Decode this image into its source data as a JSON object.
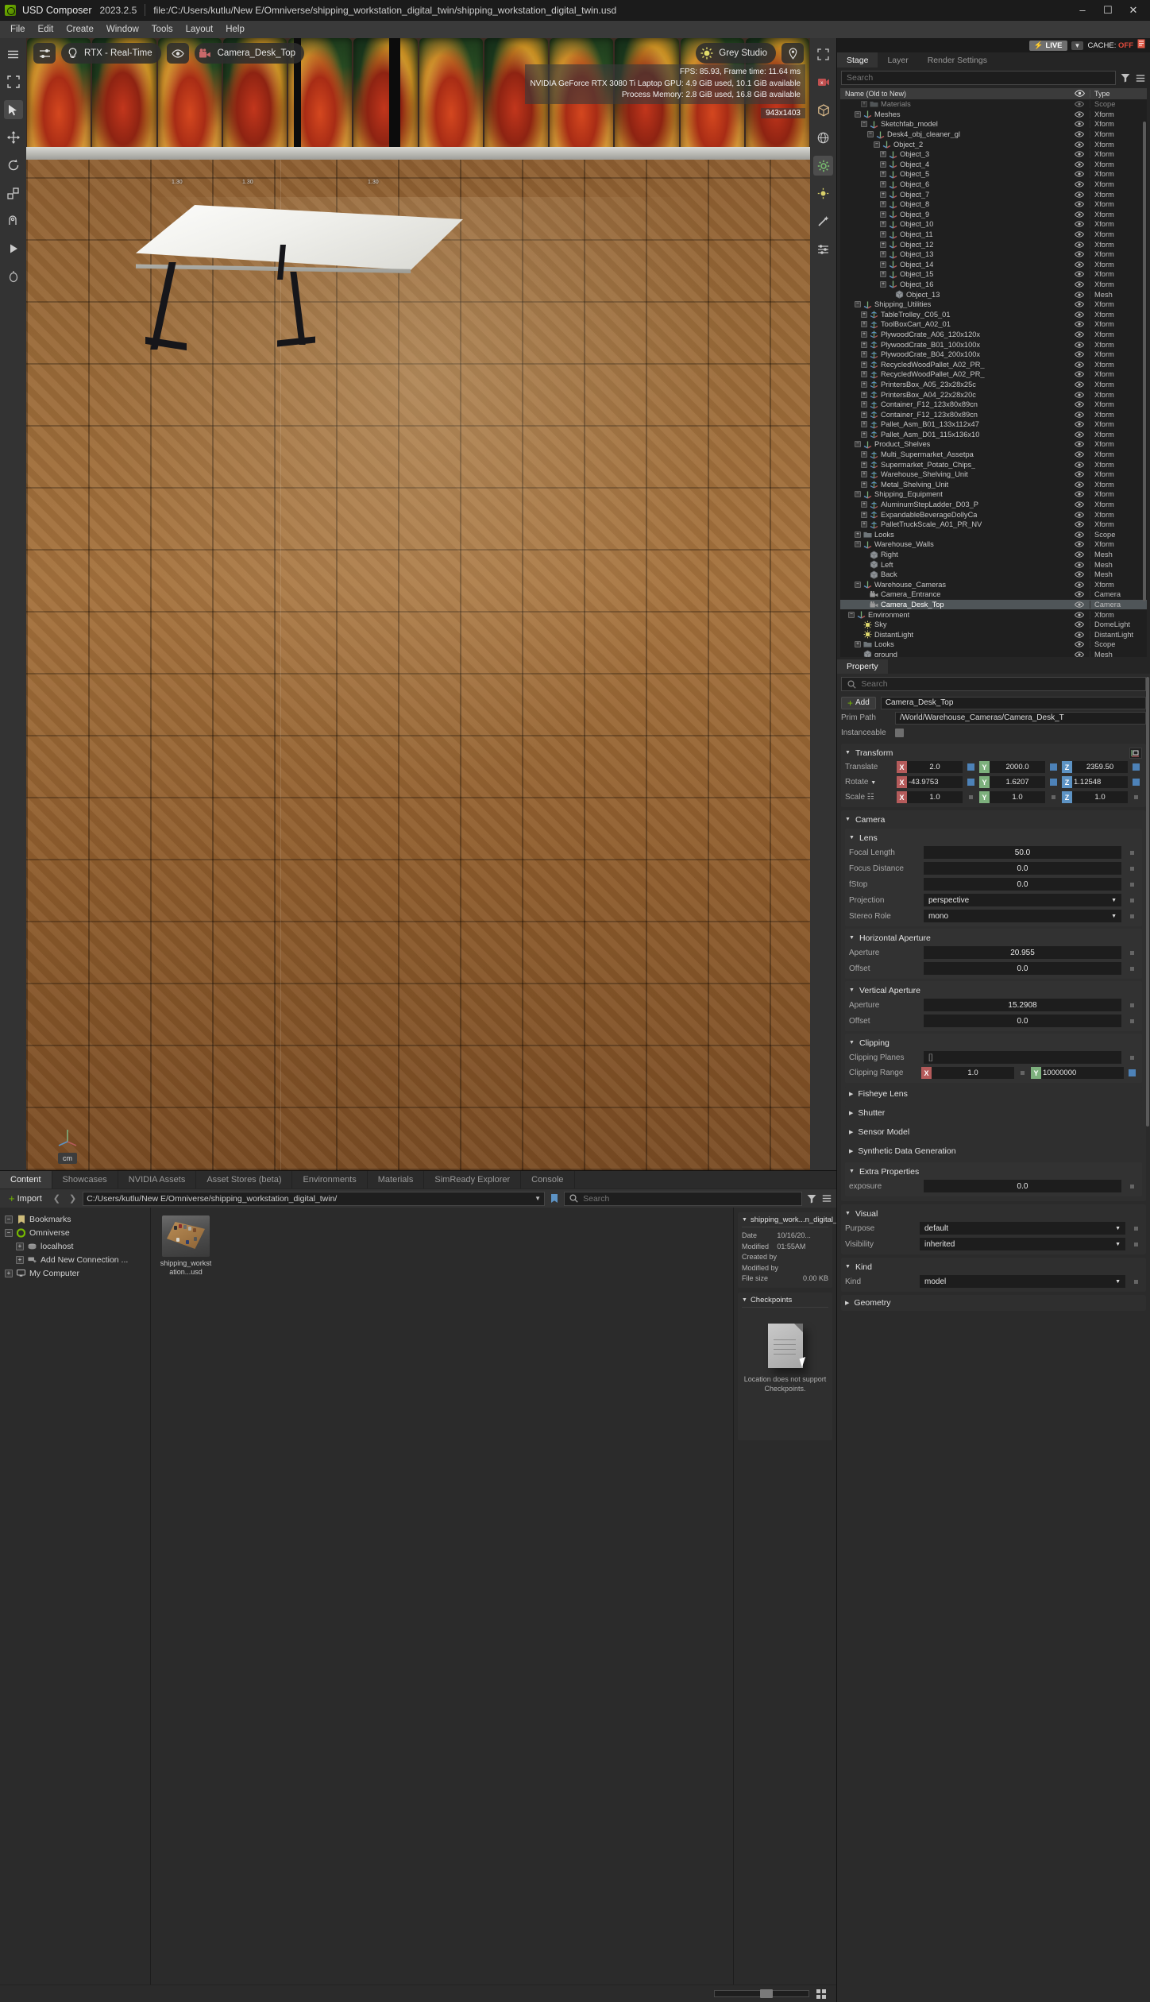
{
  "titlebar": {
    "app_name": "USD Composer",
    "version": "2023.2.5",
    "file_path": "file:/C:/Users/kutlu/New E/Omniverse/shipping_workstation_digital_twin/shipping_workstation_digital_twin.usd",
    "minimize": "–",
    "maximize": "☐",
    "close": "✕"
  },
  "menubar": {
    "items": [
      "File",
      "Edit",
      "Create",
      "Window",
      "Tools",
      "Layout",
      "Help"
    ]
  },
  "viewport": {
    "render_mode": "RTX - Real-Time",
    "camera": "Camera_Desk_Top",
    "lighting_preset": "Grey Studio",
    "stats": [
      "FPS: 85.93, Frame time: 11.64 ms",
      "NVIDIA GeForce RTX 3080 Ti Laptop GPU: 4.9 GiB used, 10.1 GiB available",
      "Process Memory: 2.8 GiB used, 16.8 GiB available"
    ],
    "resolution": "943x1403",
    "unit": "cm",
    "dimension_labels": [
      "1.30",
      "1.30",
      "1.30"
    ],
    "toolbar_icons": [
      "menu-icon",
      "select-tool-icon",
      "move-tool-icon",
      "rotate-tool-icon",
      "scale-tool-icon",
      "snap-tool-icon",
      "play-tool-icon",
      "physics-tool-icon"
    ],
    "rail_icons": [
      "expand-icon",
      "camera-record-icon",
      "cube-icon",
      "globe-icon",
      "gear-icon",
      "sun-icon",
      "wand-icon",
      "sliders-icon"
    ],
    "hud_icons": [
      "settings-sliders-icon",
      "lightbulb-icon",
      "eye-icon",
      "camera-icon",
      "sun-icon",
      "location-pin-icon"
    ]
  },
  "stage": {
    "live_label": "LIVE",
    "cache_label": "CACHE:",
    "cache_value": "OFF",
    "tabs": [
      {
        "label": "Stage",
        "active": true
      },
      {
        "label": "Layer",
        "active": false
      },
      {
        "label": "Render Settings",
        "active": false
      }
    ],
    "search_placeholder": "Search",
    "columns": {
      "name": "Name (Old to New)",
      "eye": "eye-icon",
      "type": "Type"
    },
    "rows": [
      {
        "indent": 3,
        "exp": "+",
        "icon": "scope-icon",
        "label": "Materials",
        "type": "Scope",
        "sel": false,
        "dim": true
      },
      {
        "indent": 2,
        "exp": "−",
        "icon": "xform-icon",
        "label": "Meshes",
        "type": "Xform",
        "sel": false
      },
      {
        "indent": 3,
        "exp": "−",
        "icon": "xform-icon",
        "label": "Sketchfab_model",
        "type": "Xform",
        "sel": false
      },
      {
        "indent": 4,
        "exp": "−",
        "icon": "xform-icon",
        "label": "Desk4_obj_cleaner_gl",
        "type": "Xform",
        "sel": false
      },
      {
        "indent": 5,
        "exp": "−",
        "icon": "xform-icon",
        "label": "Object_2",
        "type": "Xform",
        "sel": false
      },
      {
        "indent": 6,
        "exp": "+",
        "icon": "xform-icon",
        "label": "Object_3",
        "type": "Xform",
        "sel": false
      },
      {
        "indent": 6,
        "exp": "+",
        "icon": "xform-icon",
        "label": "Object_4",
        "type": "Xform",
        "sel": false
      },
      {
        "indent": 6,
        "exp": "+",
        "icon": "xform-icon",
        "label": "Object_5",
        "type": "Xform",
        "sel": false
      },
      {
        "indent": 6,
        "exp": "+",
        "icon": "xform-icon",
        "label": "Object_6",
        "type": "Xform",
        "sel": false
      },
      {
        "indent": 6,
        "exp": "+",
        "icon": "xform-icon",
        "label": "Object_7",
        "type": "Xform",
        "sel": false
      },
      {
        "indent": 6,
        "exp": "+",
        "icon": "xform-icon",
        "label": "Object_8",
        "type": "Xform",
        "sel": false
      },
      {
        "indent": 6,
        "exp": "+",
        "icon": "xform-icon",
        "label": "Object_9",
        "type": "Xform",
        "sel": false
      },
      {
        "indent": 6,
        "exp": "+",
        "icon": "xform-icon",
        "label": "Object_10",
        "type": "Xform",
        "sel": false
      },
      {
        "indent": 6,
        "exp": "+",
        "icon": "xform-icon",
        "label": "Object_11",
        "type": "Xform",
        "sel": false
      },
      {
        "indent": 6,
        "exp": "+",
        "icon": "xform-icon",
        "label": "Object_12",
        "type": "Xform",
        "sel": false
      },
      {
        "indent": 6,
        "exp": "+",
        "icon": "xform-icon",
        "label": "Object_13",
        "type": "Xform",
        "sel": false
      },
      {
        "indent": 6,
        "exp": "+",
        "icon": "xform-icon",
        "label": "Object_14",
        "type": "Xform",
        "sel": false
      },
      {
        "indent": 6,
        "exp": "+",
        "icon": "xform-icon",
        "label": "Object_15",
        "type": "Xform",
        "sel": false
      },
      {
        "indent": 6,
        "exp": "+",
        "icon": "xform-icon",
        "label": "Object_16",
        "type": "Xform",
        "sel": false
      },
      {
        "indent": 7,
        "exp": "",
        "icon": "mesh-icon",
        "label": "Object_13",
        "type": "Mesh",
        "sel": false
      },
      {
        "indent": 2,
        "exp": "−",
        "icon": "xform-icon",
        "label": "Shipping_Utilities",
        "type": "Xform",
        "sel": false
      },
      {
        "indent": 3,
        "exp": "+",
        "icon": "payload-icon",
        "label": "TableTrolley_C05_01",
        "type": "Xform",
        "sel": false
      },
      {
        "indent": 3,
        "exp": "+",
        "icon": "payload-icon",
        "label": "ToolBoxCart_A02_01",
        "type": "Xform",
        "sel": false
      },
      {
        "indent": 3,
        "exp": "+",
        "icon": "payload-icon",
        "label": "PlywoodCrate_A06_120x120x",
        "type": "Xform",
        "sel": false
      },
      {
        "indent": 3,
        "exp": "+",
        "icon": "payload-icon",
        "label": "PlywoodCrate_B01_100x100x",
        "type": "Xform",
        "sel": false
      },
      {
        "indent": 3,
        "exp": "+",
        "icon": "payload-icon",
        "label": "PlywoodCrate_B04_200x100x",
        "type": "Xform",
        "sel": false
      },
      {
        "indent": 3,
        "exp": "+",
        "icon": "payload-icon",
        "label": "RecycledWoodPallet_A02_PR_",
        "type": "Xform",
        "sel": false
      },
      {
        "indent": 3,
        "exp": "+",
        "icon": "payload-icon",
        "label": "RecycledWoodPallet_A02_PR_",
        "type": "Xform",
        "sel": false
      },
      {
        "indent": 3,
        "exp": "+",
        "icon": "payload-icon",
        "label": "PrintersBox_A05_23x28x25c",
        "type": "Xform",
        "sel": false
      },
      {
        "indent": 3,
        "exp": "+",
        "icon": "payload-icon",
        "label": "PrintersBox_A04_22x28x20c",
        "type": "Xform",
        "sel": false
      },
      {
        "indent": 3,
        "exp": "+",
        "icon": "payload-icon",
        "label": "Container_F12_123x80x89cn",
        "type": "Xform",
        "sel": false
      },
      {
        "indent": 3,
        "exp": "+",
        "icon": "payload-icon",
        "label": "Container_F12_123x80x89cn",
        "type": "Xform",
        "sel": false
      },
      {
        "indent": 3,
        "exp": "+",
        "icon": "payload-icon",
        "label": "Pallet_Asm_B01_133x112x47",
        "type": "Xform",
        "sel": false
      },
      {
        "indent": 3,
        "exp": "+",
        "icon": "payload-icon",
        "label": "Pallet_Asm_D01_115x136x10",
        "type": "Xform",
        "sel": false
      },
      {
        "indent": 2,
        "exp": "−",
        "icon": "xform-icon",
        "label": "Product_Shelves",
        "type": "Xform",
        "sel": false
      },
      {
        "indent": 3,
        "exp": "+",
        "icon": "payload-icon",
        "label": "Multi_Supermarket_Assetpa",
        "type": "Xform",
        "sel": false
      },
      {
        "indent": 3,
        "exp": "+",
        "icon": "payload-icon",
        "label": "Supermarket_Potato_Chips_",
        "type": "Xform",
        "sel": false
      },
      {
        "indent": 3,
        "exp": "+",
        "icon": "payload-icon",
        "label": "Warehouse_Shelving_Unit",
        "type": "Xform",
        "sel": false
      },
      {
        "indent": 3,
        "exp": "+",
        "icon": "payload-icon",
        "label": "Metal_Shelving_Unit",
        "type": "Xform",
        "sel": false
      },
      {
        "indent": 2,
        "exp": "−",
        "icon": "xform-icon",
        "label": "Shipping_Equipment",
        "type": "Xform",
        "sel": false
      },
      {
        "indent": 3,
        "exp": "+",
        "icon": "payload-icon",
        "label": "AluminumStepLadder_D03_P",
        "type": "Xform",
        "sel": false
      },
      {
        "indent": 3,
        "exp": "+",
        "icon": "payload-icon",
        "label": "ExpandableBeverageDollyCa",
        "type": "Xform",
        "sel": false
      },
      {
        "indent": 3,
        "exp": "+",
        "icon": "payload-icon",
        "label": "PalletTruckScale_A01_PR_NV",
        "type": "Xform",
        "sel": false
      },
      {
        "indent": 2,
        "exp": "+",
        "icon": "scope-icon",
        "label": "Looks",
        "type": "Scope",
        "sel": false
      },
      {
        "indent": 2,
        "exp": "−",
        "icon": "xform-icon",
        "label": "Warehouse_Walls",
        "type": "Xform",
        "sel": false
      },
      {
        "indent": 3,
        "exp": "",
        "icon": "mesh-icon",
        "label": "Right",
        "type": "Mesh",
        "sel": false
      },
      {
        "indent": 3,
        "exp": "",
        "icon": "mesh-icon",
        "label": "Left",
        "type": "Mesh",
        "sel": false
      },
      {
        "indent": 3,
        "exp": "",
        "icon": "mesh-icon",
        "label": "Back",
        "type": "Mesh",
        "sel": false
      },
      {
        "indent": 2,
        "exp": "−",
        "icon": "xform-icon",
        "label": "Warehouse_Cameras",
        "type": "Xform",
        "sel": false
      },
      {
        "indent": 3,
        "exp": "",
        "icon": "camera-icon",
        "label": "Camera_Entrance",
        "type": "Camera",
        "sel": false
      },
      {
        "indent": 3,
        "exp": "",
        "icon": "camera-icon",
        "label": "Camera_Desk_Top",
        "type": "Camera",
        "sel": true
      },
      {
        "indent": 1,
        "exp": "−",
        "icon": "xform-icon",
        "label": "Environment",
        "type": "Xform",
        "sel": false
      },
      {
        "indent": 2,
        "exp": "",
        "icon": "light-icon",
        "label": "Sky",
        "type": "DomeLight",
        "sel": false
      },
      {
        "indent": 2,
        "exp": "",
        "icon": "light-icon",
        "label": "DistantLight",
        "type": "DistantLight",
        "sel": false
      },
      {
        "indent": 2,
        "exp": "+",
        "icon": "scope-icon",
        "label": "Looks",
        "type": "Scope",
        "sel": false
      },
      {
        "indent": 2,
        "exp": "",
        "icon": "mesh-icon",
        "label": "ground",
        "type": "Mesh",
        "sel": false
      }
    ]
  },
  "property": {
    "tab_label": "Property",
    "search_placeholder": "Search",
    "add_label": "Add",
    "prim_name": "Camera_Desk_Top",
    "prim_path_label": "Prim Path",
    "prim_path_value": "/World/Warehouse_Cameras/Camera_Desk_T",
    "instanceable_label": "Instanceable",
    "transform": {
      "title": "Transform",
      "translate_label": "Translate",
      "translate": {
        "x": "2.0",
        "y": "2000.0",
        "z": "2359.50"
      },
      "rotate_label": "Rotate",
      "rotate": {
        "x": "-43.9753",
        "y": "1.6207",
        "z": "1.12548"
      },
      "scale_label": "Scale",
      "scale": {
        "x": "1.0",
        "y": "1.0",
        "z": "1.0"
      }
    },
    "camera": {
      "title": "Camera",
      "lens": {
        "title": "Lens",
        "rows": [
          {
            "label": "Focal Length",
            "value": "50.0",
            "type": "num"
          },
          {
            "label": "Focus Distance",
            "value": "0.0",
            "type": "num"
          },
          {
            "label": "fStop",
            "value": "0.0",
            "type": "num"
          },
          {
            "label": "Projection",
            "value": "perspective",
            "type": "select"
          },
          {
            "label": "Stereo Role",
            "value": "mono",
            "type": "select"
          }
        ]
      },
      "horizontal_aperture": {
        "title": "Horizontal Aperture",
        "rows": [
          {
            "label": "Aperture",
            "value": "20.955",
            "type": "num"
          },
          {
            "label": "Offset",
            "value": "0.0",
            "type": "num"
          }
        ]
      },
      "vertical_aperture": {
        "title": "Vertical Aperture",
        "rows": [
          {
            "label": "Aperture",
            "value": "15.2908",
            "type": "num"
          },
          {
            "label": "Offset",
            "value": "0.0",
            "type": "num"
          }
        ]
      },
      "clipping": {
        "title": "Clipping",
        "planes_label": "Clipping Planes",
        "planes_value": "[]",
        "range_label": "Clipping Range",
        "range": {
          "x": "1.0",
          "y": "10000000"
        }
      },
      "collapsed_sections": [
        "Fisheye Lens",
        "Shutter",
        "Sensor Model",
        "Synthetic Data Generation"
      ],
      "extra": {
        "title": "Extra Properties",
        "rows": [
          {
            "label": "exposure",
            "value": "0.0",
            "type": "num"
          }
        ]
      }
    },
    "visual": {
      "title": "Visual",
      "rows": [
        {
          "label": "Purpose",
          "value": "default",
          "type": "select"
        },
        {
          "label": "Visibility",
          "value": "inherited",
          "type": "select"
        }
      ]
    },
    "kind": {
      "title": "Kind",
      "rows": [
        {
          "label": "Kind",
          "value": "model",
          "type": "select"
        }
      ]
    },
    "geometry_title": "Geometry"
  },
  "content": {
    "tabs": [
      {
        "label": "Content",
        "active": true
      },
      {
        "label": "Showcases",
        "active": false
      },
      {
        "label": "NVIDIA Assets",
        "active": false
      },
      {
        "label": "Asset Stores (beta)",
        "active": false
      },
      {
        "label": "Environments",
        "active": false
      },
      {
        "label": "Materials",
        "active": false
      },
      {
        "label": "SimReady Explorer",
        "active": false
      },
      {
        "label": "Console",
        "active": false
      }
    ],
    "import_label": "Import",
    "path": "C:/Users/kutlu/New E/Omniverse/shipping_workstation_digital_twin/",
    "search_placeholder": "Search",
    "tree": [
      {
        "indent": 0,
        "exp": "−",
        "icon": "bookmark-icon",
        "label": "Bookmarks"
      },
      {
        "indent": 0,
        "exp": "−",
        "icon": "omniverse-icon",
        "label": "Omniverse"
      },
      {
        "indent": 1,
        "exp": "+",
        "icon": "server-icon",
        "label": "localhost"
      },
      {
        "indent": 1,
        "exp": "+",
        "icon": "add-connection-icon",
        "label": "Add New Connection ..."
      },
      {
        "indent": 0,
        "exp": "+",
        "icon": "computer-icon",
        "label": "My Computer"
      }
    ],
    "assets": [
      {
        "label": "shipping_workstation...usd"
      }
    ],
    "detail": {
      "title": "shipping_work...n_digital_twin",
      "rows": [
        {
          "key": "Date Modified",
          "value": "10/16/20... 01:55AM"
        },
        {
          "key": "Created by",
          "value": ""
        },
        {
          "key": "Modified by",
          "value": ""
        },
        {
          "key": "File size",
          "value": "0.00 KB"
        }
      ],
      "checkpoints_title": "Checkpoints",
      "checkpoints_message": "Location does not support Checkpoints."
    }
  },
  "colors": {
    "accent_green": "#76b900",
    "axis_x": "#b55b5b",
    "axis_y": "#7db07d",
    "axis_z": "#5d93c4",
    "cache_off": "#e24b3c",
    "selection": "#4f5558"
  }
}
